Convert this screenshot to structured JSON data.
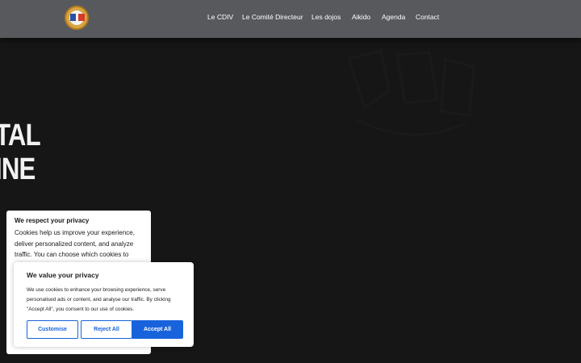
{
  "header": {
    "logo_name": "cdiv-logo",
    "nav": [
      {
        "label": "Le CDIV"
      },
      {
        "label": "Le Comité Directeur"
      },
      {
        "label": "Les dojos"
      },
      {
        "label": "Aikido"
      },
      {
        "label": "Agenda"
      },
      {
        "label": "Contact"
      }
    ]
  },
  "hero": {
    "title_line1": "TAL",
    "title_line2": "INE"
  },
  "privacy_back": {
    "title": "We respect your privacy",
    "text": "Cookies help us improve your experience, deliver personalized content, and analyze traffic. You can choose which cookies to"
  },
  "consent": {
    "title": "We value your privacy",
    "text": "We use cookies to enhance your browsing experience, serve personalised ads or content, and analyse our traffic. By clicking \"Accept All\", you consent to our use of cookies.",
    "buttons": {
      "customise": "Customise",
      "reject": "Reject All",
      "accept": "Accept All"
    }
  },
  "colors": {
    "header_bg": "#57595d",
    "page_bg": "#161616",
    "accent": "#1863dc"
  }
}
